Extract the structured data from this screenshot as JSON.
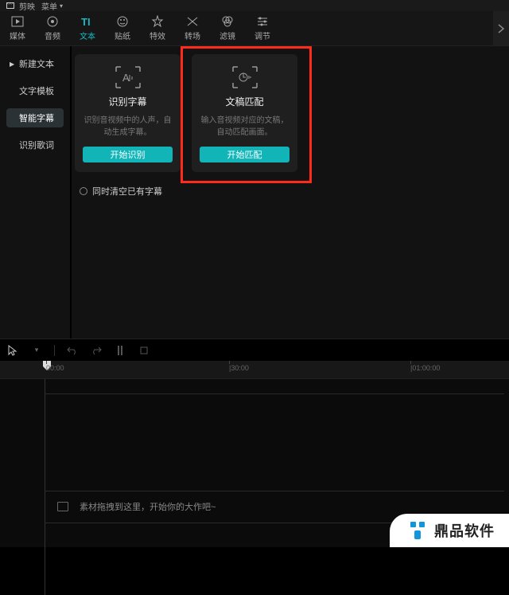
{
  "titlebar": {
    "appName": "剪映",
    "menuLabel": "菜单"
  },
  "tabs": [
    {
      "id": "media",
      "label": "媒体"
    },
    {
      "id": "audio",
      "label": "音频"
    },
    {
      "id": "text",
      "label": "文本",
      "active": true
    },
    {
      "id": "sticker",
      "label": "贴纸"
    },
    {
      "id": "effect",
      "label": "特效"
    },
    {
      "id": "trans",
      "label": "转场"
    },
    {
      "id": "filter",
      "label": "滤镜"
    },
    {
      "id": "adjust",
      "label": "调节"
    }
  ],
  "sidebar": [
    {
      "label": "新建文本",
      "expandable": true
    },
    {
      "label": "文字模板"
    },
    {
      "label": "智能字幕",
      "active": true
    },
    {
      "label": "识别歌词"
    }
  ],
  "cards": {
    "recognize": {
      "title": "识别字幕",
      "desc": "识别音视频中的人声，自动生成字幕。",
      "button": "开始识别"
    },
    "match": {
      "title": "文稿匹配",
      "desc": "输入音视频对应的文稿，自动匹配画面。",
      "button": "开始匹配"
    }
  },
  "clearExisting": "同时清空已有字幕",
  "timelineMarks": [
    "00:00",
    "|30:00",
    "|01:00:00"
  ],
  "placeholder": "素材拖拽到这里，开始你的大作吧~",
  "watermark": "鼎品软件",
  "colors": {
    "accent": "#11b5b8",
    "highlight": "#ff2b1a"
  }
}
